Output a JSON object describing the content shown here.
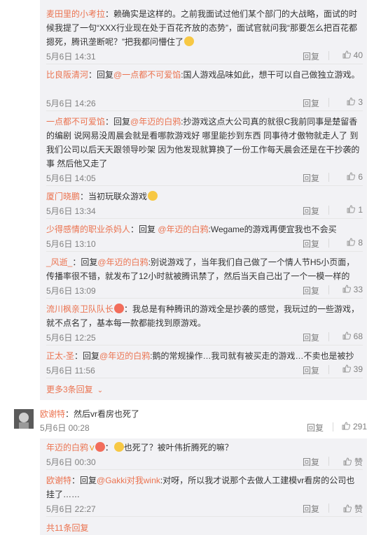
{
  "like_icon": "thumbs-up-icon",
  "reply_label": "回复",
  "replies": [
    {
      "user": "麦田里的小考拉",
      "colon": "：",
      "content": "赖确实是这样的。之前我面试过他们某个部门的大战略，面试的时候我提了一句“XXX行业现在处于百花齐放的态势”，面试官就问我“那要怎么把百花都摁死，腾讯垄断呢？”把我都问懵住了",
      "emoji": "sweat-smile-emoji",
      "time": "5月6日 14:31",
      "likes": "40"
    },
    {
      "user": "比良阪清河",
      "prefix": "：回复",
      "mention": "@一点都不可爱馅",
      "content": ":国人游戏品味如此，想干可以自己做独立游戏。",
      "time": "5月6日 14:26",
      "likes": "3"
    },
    {
      "user": "一点都不可爱馅",
      "prefix": "：回复",
      "mention": "@年迈的白鸦",
      "content": ":抄游戏这点大公司真的就很C我前同事是楚留香的编剧 说网易没周晨会就是看哪款游戏好 哪里能抄到东西 同事待才傲物就走人了 到我们公司以后天天跟领导吵架 因为他发现就算换了一份工作每天晨会还是在干抄袭的事 然后他又走了",
      "time": "5月6日 14:05",
      "likes": "6"
    },
    {
      "user": "厦门晓鹏",
      "colon": "：",
      "content": "当初玩联众游戏",
      "emoji": "grin-emoji",
      "time": "5月6日 13:34",
      "likes": "1"
    },
    {
      "user": "少得感情的职业杀妈人",
      "prefix": "：回复 ",
      "mention": "@年迈的白鸦",
      "content": ":Wegame的游戏再便宜我也不会买",
      "time": "5月6日 13:10",
      "likes": "8"
    },
    {
      "user": "_风逝_",
      "prefix": "：回复",
      "mention": "@年迈的白鸦",
      "content": ":别说游戏了，当年我们自己做了一个情人节H5小页面，传播率很不错，就发布了12小时就被腾讯禁了，然后当天自己出了一个一模一样的",
      "time": "5月6日 13:09",
      "likes": "33"
    },
    {
      "user": "流川枫亲卫队队长",
      "badge": "fire-badge",
      "colon": "：",
      "content": "我总是有种腾讯的游戏全是抄袭的感觉，我玩过的一些游戏，就不点名了，基本每一款都能找到原游戏。",
      "time": "5月6日 12:25",
      "likes": "68"
    },
    {
      "user": "正太-圣",
      "prefix": "：回复",
      "mention": "@年迈的白鸦",
      "content": ":鹅的常规操作…我司就有被买走的游戏…不卖也是被抄",
      "time": "5月6日 11:56",
      "likes": "39"
    }
  ],
  "more_replies": "更多3条回复",
  "main_comment": {
    "user": "欧谢特",
    "colon": "：",
    "content": "然后vr看房也死了",
    "time": "5月6日 00:28",
    "likes": "291"
  },
  "sub_replies": [
    {
      "user": "年迈的白鸦",
      "vip": "V",
      "badge": "heart-badge",
      "colon": "：",
      "emoji": "smile-emoji",
      "content": "也死了？被叶伟折腾死的嘛？",
      "time": "5月6日 00:30",
      "likes": "赞"
    },
    {
      "user": "欧谢特",
      "prefix": "：回复",
      "mention": "@Gakki对我wink",
      "content": ":对呀，所以我才说那个去做人工建模vr看房的公司也挂了……",
      "time": "5月6日 22:27",
      "likes": "赞"
    }
  ],
  "total_replies": "共11条回复"
}
